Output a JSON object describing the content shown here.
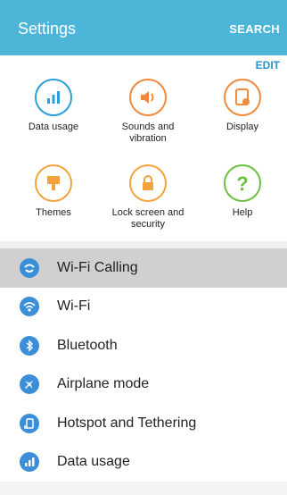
{
  "header": {
    "title": "Settings",
    "search_label": "SEARCH"
  },
  "quick_settings": {
    "edit_label": "EDIT",
    "items": [
      {
        "label": "Data usage",
        "icon": "bar-chart-icon",
        "color": "#2a9fd8"
      },
      {
        "label": "Sounds and vibration",
        "icon": "speaker-icon",
        "color": "#f28a3d"
      },
      {
        "label": "Display",
        "icon": "display-icon",
        "color": "#f28a3d"
      },
      {
        "label": "Themes",
        "icon": "paintbrush-icon",
        "color": "#f2a33d"
      },
      {
        "label": "Lock screen and security",
        "icon": "lock-icon",
        "color": "#f2a33d"
      },
      {
        "label": "Help",
        "icon": "question-icon",
        "color": "#6cbf3f"
      }
    ]
  },
  "settings_list": [
    {
      "label": "Wi-Fi Calling",
      "icon": "wifi-calling-icon",
      "selected": true
    },
    {
      "label": "Wi-Fi",
      "icon": "wifi-icon",
      "selected": false
    },
    {
      "label": "Bluetooth",
      "icon": "bluetooth-icon",
      "selected": false
    },
    {
      "label": "Airplane mode",
      "icon": "airplane-icon",
      "selected": false
    },
    {
      "label": "Hotspot and Tethering",
      "icon": "hotspot-icon",
      "selected": false
    },
    {
      "label": "Data usage",
      "icon": "data-usage-icon",
      "selected": false
    }
  ]
}
